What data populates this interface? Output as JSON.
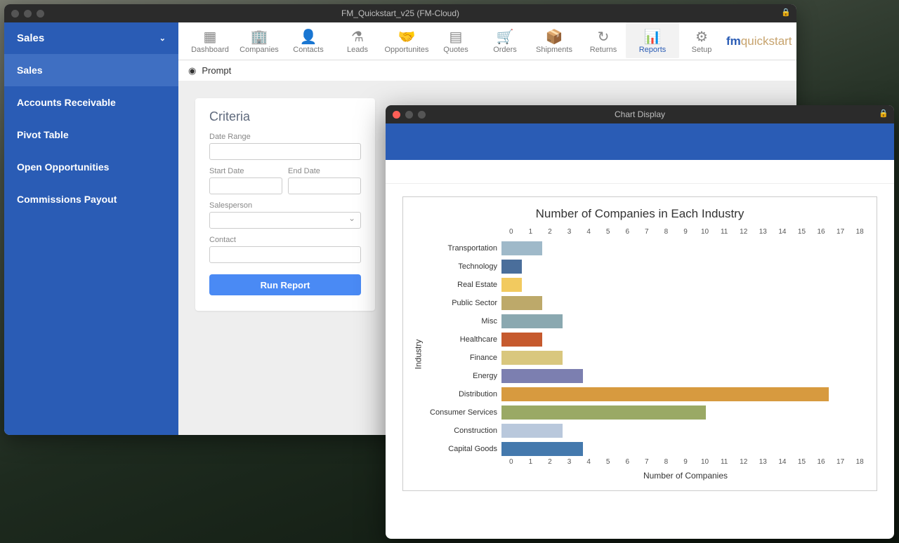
{
  "main_window": {
    "title": "FM_Quickstart_v25 (FM-Cloud)",
    "brand_fm": "fm",
    "brand_rest": "quickstart",
    "sidebar": {
      "header": "Sales",
      "items": [
        "Sales",
        "Accounts Receivable",
        "Pivot Table",
        "Open Opportunities",
        "Commissions Payout"
      ],
      "active_index": 0
    },
    "tabs": [
      "Dashboard",
      "Companies",
      "Contacts",
      "Leads",
      "Opportunites",
      "Quotes",
      "Orders",
      "Shipments",
      "Returns",
      "Reports",
      "Setup"
    ],
    "active_tab_index": 9,
    "prompt_label": "Prompt",
    "criteria": {
      "heading": "Criteria",
      "date_range_label": "Date Range",
      "start_date_label": "Start Date",
      "end_date_label": "End Date",
      "salesperson_label": "Salesperson",
      "contact_label": "Contact",
      "run_label": "Run Report"
    }
  },
  "chart_window": {
    "title": "Chart Display"
  },
  "chart_data": {
    "type": "bar",
    "orientation": "horizontal",
    "title": "Number of Companies in Each Industry",
    "xlabel": "Number of Companies",
    "ylabel": "Industry",
    "xlim": [
      0,
      18
    ],
    "xticks": [
      0,
      1,
      2,
      3,
      4,
      5,
      6,
      7,
      8,
      9,
      10,
      11,
      12,
      13,
      14,
      15,
      16,
      17,
      18
    ],
    "categories": [
      "Transportation",
      "Technology",
      "Real Estate",
      "Public Sector",
      "Misc",
      "Healthcare",
      "Finance",
      "Energy",
      "Distribution",
      "Consumer Services",
      "Construction",
      "Capital Goods"
    ],
    "values": [
      2,
      1,
      1,
      2,
      3,
      2,
      3,
      4,
      16,
      10,
      3,
      4
    ],
    "colors": [
      "#9fb9c9",
      "#4a6e9b",
      "#f2ca5f",
      "#bda96a",
      "#8aa8b0",
      "#c65a2e",
      "#d9c77e",
      "#7c7fb0",
      "#d79a3f",
      "#9aa965",
      "#b9c8dc",
      "#4479ad"
    ]
  }
}
